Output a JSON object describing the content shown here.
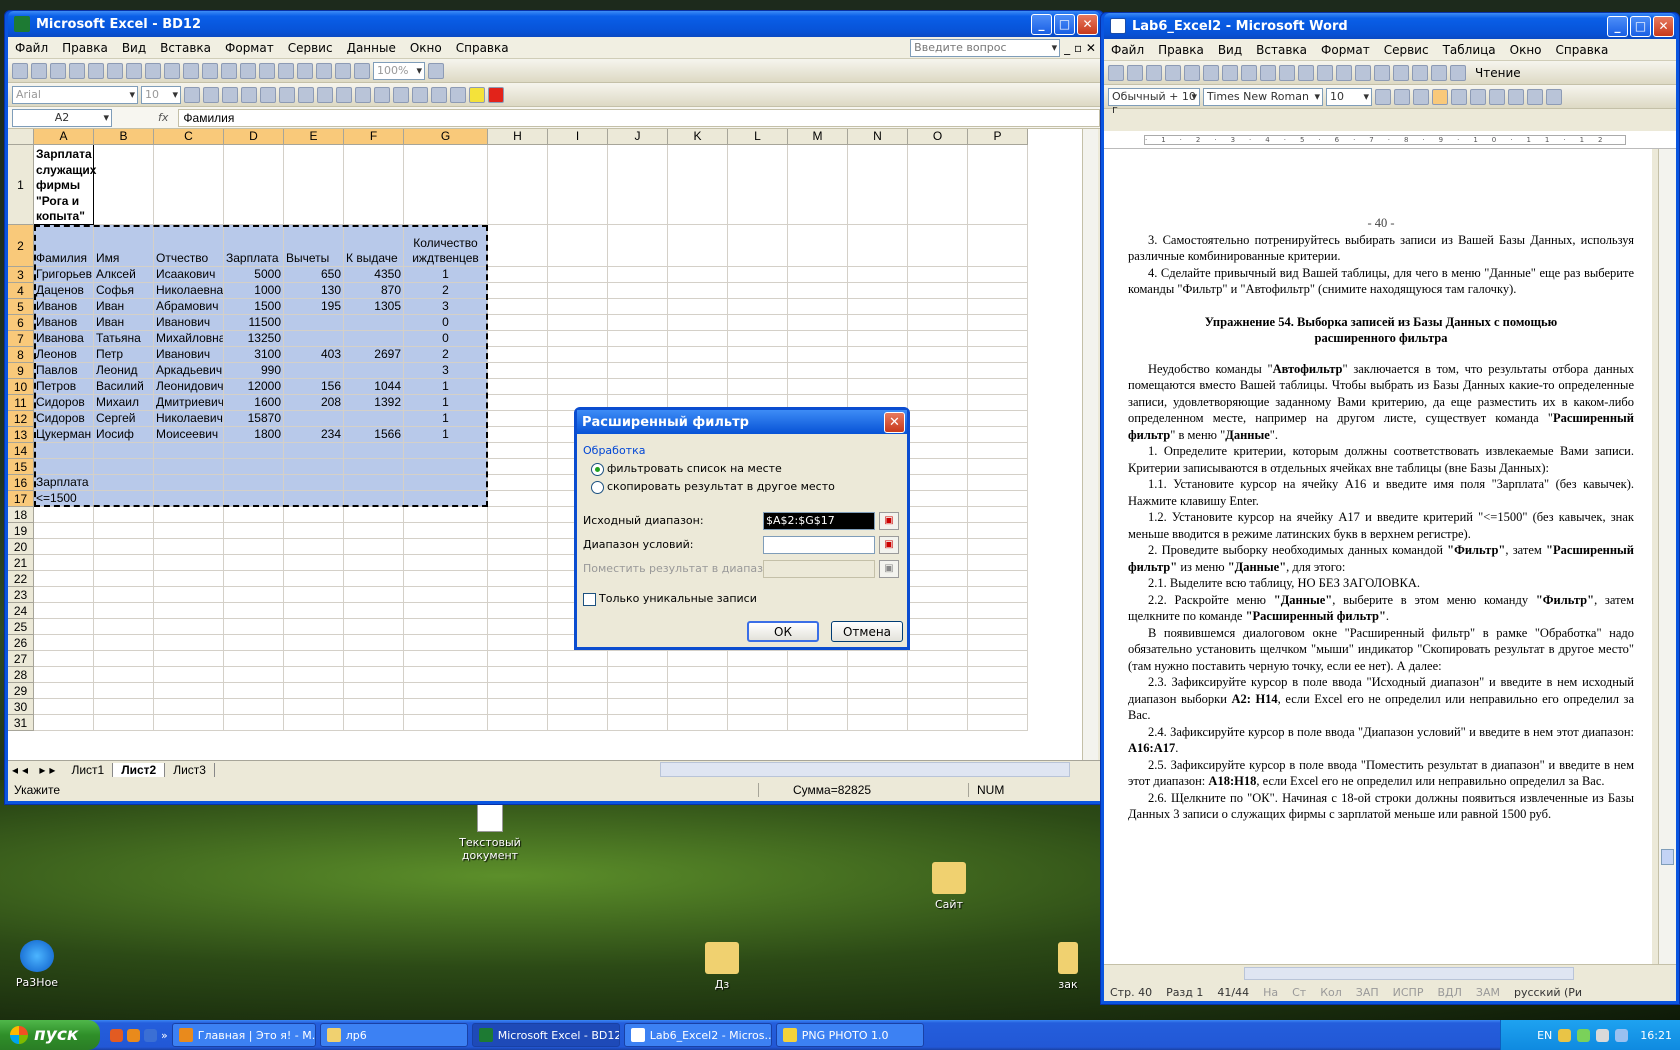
{
  "desktop": {
    "icons": [
      {
        "label": "Текстовый документ"
      },
      {
        "label": "Сайт"
      },
      {
        "label": "Ра3Ное"
      },
      {
        "label": "Дз"
      },
      {
        "label": "зак"
      }
    ]
  },
  "excel": {
    "title": "Microsoft Excel - BD12",
    "menu": [
      "Файл",
      "Правка",
      "Вид",
      "Вставка",
      "Формат",
      "Сервис",
      "Данные",
      "Окно",
      "Справка"
    ],
    "help_placeholder": "Введите вопрос",
    "zoom": "100%",
    "font": "Arial",
    "font_size": "10",
    "name_box": "A2",
    "fx": "fx",
    "formula": "Фамилия",
    "col_headers": [
      "A",
      "B",
      "C",
      "D",
      "E",
      "F",
      "G",
      "H",
      "I",
      "J",
      "K",
      "L",
      "M",
      "N",
      "O",
      "P"
    ],
    "row1_title": "Зарплата служащих фирмы \"Рога и копыта\"",
    "headers": [
      "Фамилия",
      "Имя",
      "Отчество",
      "Зарплата",
      "Вычеты",
      "К выдаче",
      "Количество иждтвенцев"
    ],
    "rows": [
      [
        "Григорьев",
        "Алксей",
        "Исаакович",
        "5000",
        "650",
        "4350",
        "1"
      ],
      [
        "Даценов",
        "Софья",
        "Николаевна",
        "1000",
        "130",
        "870",
        "2"
      ],
      [
        "Иванов",
        "Иван",
        "Абрамович",
        "1500",
        "195",
        "1305",
        "3"
      ],
      [
        "Иванов",
        "Иван",
        "Иванович",
        "11500",
        "",
        "",
        "0"
      ],
      [
        "Иванова",
        "Татьяна",
        "Михайловна",
        "13250",
        "",
        "",
        "0"
      ],
      [
        "Леонов",
        "Петр",
        "Иванович",
        "3100",
        "403",
        "2697",
        "2"
      ],
      [
        "Павлов",
        "Леонид",
        "Аркадьевич",
        "990",
        "",
        "",
        "3"
      ],
      [
        "Петров",
        "Василий",
        "Леонидович",
        "12000",
        "156",
        "1044",
        "1"
      ],
      [
        "Сидоров",
        "Михаил",
        "Дмитриевич",
        "1600",
        "208",
        "1392",
        "1"
      ],
      [
        "Сидоров",
        "Сергей",
        "Николаевич",
        "15870",
        "",
        "",
        "1"
      ],
      [
        "Цукерман",
        "Иосиф",
        "Моисеевич",
        "1800",
        "234",
        "1566",
        "1"
      ]
    ],
    "a16": "Зарплата",
    "a17": "<=1500",
    "sheets": [
      "Лист1",
      "Лист2",
      "Лист3"
    ],
    "status_left": "Укажите",
    "status_sum": "Сумма=82825",
    "status_num": "NUM"
  },
  "dialog": {
    "title": "Расширенный фильтр",
    "group": "Обработка",
    "opt1": "фильтровать список на месте",
    "opt2": "скопировать результат в другое место",
    "src_label": "Исходный диапазон:",
    "src_value": "$A$2:$G$17",
    "crit_label": "Диапазон условий:",
    "crit_value": "",
    "dest_label": "Поместить результат в диапазон:",
    "unique": "Только уникальные записи",
    "ok": "ОК",
    "cancel": "Отмена"
  },
  "word": {
    "title": "Lab6_Excel2 - Microsoft Word",
    "menu": [
      "Файл",
      "Правка",
      "Вид",
      "Вставка",
      "Формат",
      "Сервис",
      "Таблица",
      "Окно",
      "Справка"
    ],
    "reading": "Чтение",
    "style": "Обычный + 10 г",
    "font": "Times New Roman",
    "size": "10",
    "page_num": "- 40 -",
    "status": [
      "Стр. 40",
      "Разд 1",
      "41/44",
      "На",
      "Ст",
      "Кол",
      "ЗАП",
      "ИСПР",
      "ВДЛ",
      "ЗАМ",
      "русский (Ри"
    ]
  },
  "taskbar": {
    "start": "пуск",
    "tasks": [
      "Главная | Это я! - М...",
      "лр6",
      "Microsoft Excel - BD12",
      "Lab6_Excel2 - Micros...",
      "PNG PHOTO 1.0"
    ],
    "lang": "EN",
    "time": "16:21"
  }
}
